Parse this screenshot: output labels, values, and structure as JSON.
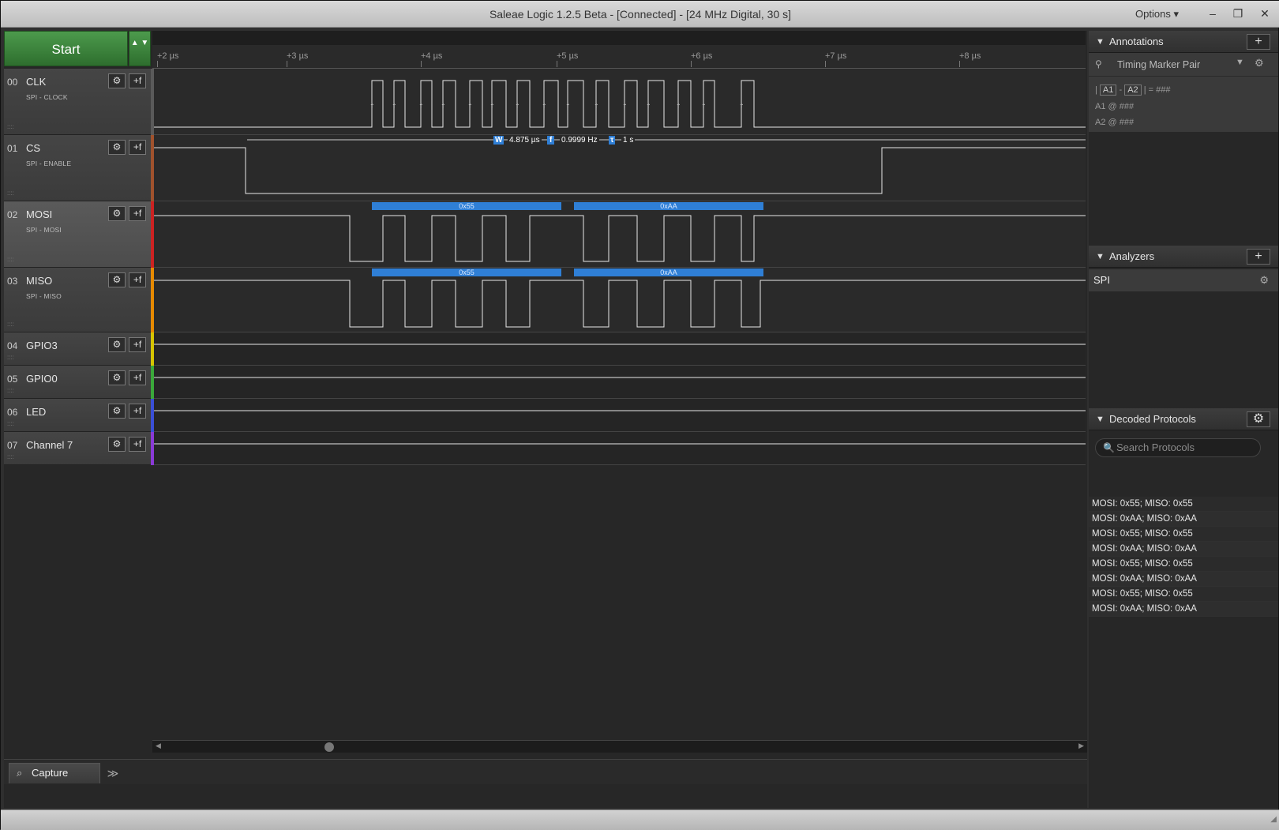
{
  "window": {
    "title": "Saleae Logic 1.2.5 Beta - [Connected] - [24 MHz Digital, 30 s]",
    "options_label": "Options ▾",
    "minimize": "–",
    "restore": "❐",
    "close": "✕"
  },
  "toolbar": {
    "start_label": "Start",
    "start_arrows": "▲ ▼"
  },
  "ruler": {
    "ticks": [
      "+2 µs",
      "+3 µs",
      "+4 µs",
      "+5 µs",
      "+6 µs",
      "+7 µs",
      "+8 µs"
    ]
  },
  "channels": [
    {
      "num": "00",
      "name": "CLK",
      "sub": "SPI - CLOCK",
      "color": "#5a5a5a"
    },
    {
      "num": "01",
      "name": "CS",
      "sub": "SPI - ENABLE",
      "color": "#a0522d"
    },
    {
      "num": "02",
      "name": "MOSI",
      "sub": "SPI - MOSI",
      "color": "#cc2222"
    },
    {
      "num": "03",
      "name": "MISO",
      "sub": "SPI - MISO",
      "color": "#e68a00"
    },
    {
      "num": "04",
      "name": "GPIO3",
      "sub": "",
      "color": "#d6c400"
    },
    {
      "num": "05",
      "name": "GPIO0",
      "sub": "",
      "color": "#3aa83a"
    },
    {
      "num": "06",
      "name": "LED",
      "sub": "",
      "color": "#3a4fd6"
    },
    {
      "num": "07",
      "name": "Channel 7",
      "sub": "",
      "color": "#8a3ad6"
    }
  ],
  "measurements": {
    "w_icon": "W",
    "width": "4.875 µs",
    "f_icon": "f",
    "freq": "0.9999 Hz",
    "t_icon": "τ",
    "period": "1 s"
  },
  "decode_bars": {
    "mosi": [
      "0x55",
      "0xAA"
    ],
    "miso": [
      "0x55",
      "0xAA"
    ]
  },
  "bottom_tabs": {
    "capture": "Capture",
    "more": "≫"
  },
  "annotations": {
    "header": "Annotations",
    "add": "+",
    "marker": "Timing Marker Pair",
    "pair_a1": "A1",
    "pair_sep": "-",
    "pair_a2": "A2",
    "pair_eq": "| = ###",
    "a1_line": "A1  @  ###",
    "a2_line": "A2  @  ###"
  },
  "analyzers": {
    "header": "Analyzers",
    "add": "+",
    "items": [
      "SPI"
    ]
  },
  "decoded": {
    "header": "Decoded Protocols",
    "search_placeholder": "Search Protocols",
    "rows": [
      "MOSI: 0x55;  MISO: 0x55",
      "MOSI: 0xAA;  MISO: 0xAA",
      "MOSI: 0x55;  MISO: 0x55",
      "MOSI: 0xAA;  MISO: 0xAA",
      "MOSI: 0x55;  MISO: 0x55",
      "MOSI: 0xAA;  MISO: 0xAA",
      "MOSI: 0x55;  MISO: 0x55",
      "MOSI: 0xAA;  MISO: 0xAA"
    ]
  }
}
